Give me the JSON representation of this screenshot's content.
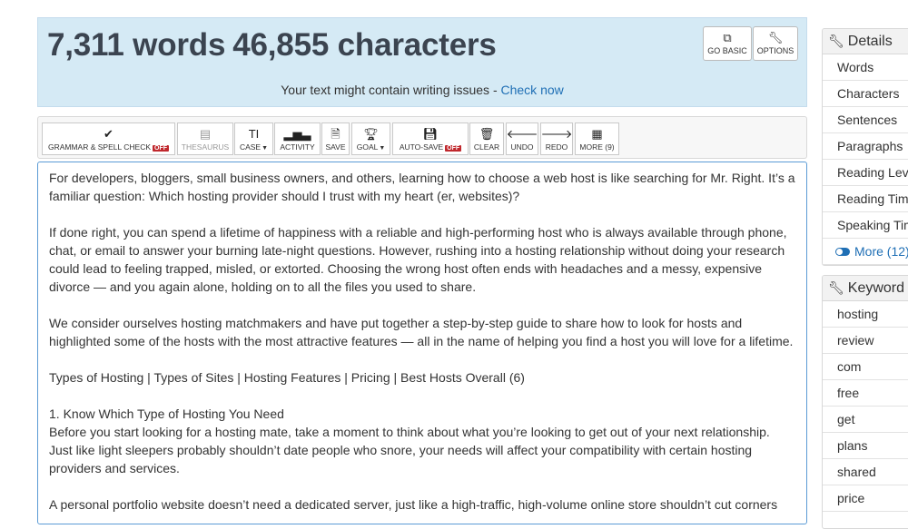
{
  "header": {
    "word_count": "7,311 words",
    "char_count": "46,855 characters",
    "go_basic_label": "GO BASIC",
    "options_label": "OPTIONS",
    "issues_text": "Your text might contain writing issues - ",
    "issues_link": "Check now"
  },
  "toolbar": {
    "grammar_label": "GRAMMAR & SPELL CHECK",
    "grammar_state": "OFF",
    "thesaurus_label": "THESAURUS",
    "case_label": "CASE",
    "activity_label": "ACTIVITY",
    "save_label": "SAVE",
    "goal_label": "GOAL",
    "autosave_label": "AUTO-SAVE",
    "autosave_state": "OFF",
    "clear_label": "CLEAR",
    "undo_label": "UNDO",
    "redo_label": "REDO",
    "more_label": "MORE (9)"
  },
  "editor": {
    "paragraphs": [
      "For developers, bloggers, small business owners, and others, learning how to choose a web host is like searching for Mr. Right. It’s a familiar question: Which hosting provider should I trust with my heart (er, websites)?",
      "If done right, you can spend a lifetime of happiness with a reliable and high-performing host who is always available through phone, chat, or email to answer your burning late-night questions. However, rushing into a hosting relationship without doing your research could lead to feeling trapped, misled, or extorted. Choosing the wrong host often ends with headaches and a messy, expensive divorce — and you again alone, holding on to all the files you used to share.",
      "We consider ourselves hosting matchmakers and have put together a step-by-step guide to share how to look for hosts and highlighted some of the hosts with the most attractive features — all in the name of helping you find a host you will love for a lifetime.",
      "Types of Hosting | Types of Sites | Hosting Features | Pricing | Best Hosts Overall (6)",
      "1. Know Which Type of Hosting You Need",
      "Before you start looking for a hosting mate, take a moment to think about what you’re looking to get out of your next relationship. Just like light sleepers probably shouldn’t date people who snore, your needs will affect your compatibility with certain hosting providers and services.",
      "A personal portfolio website doesn’t need a dedicated server, just like a high-traffic, high-volume online store shouldn’t cut corners"
    ]
  },
  "details": {
    "title": "Details",
    "rows": [
      "Words",
      "Characters",
      "Sentences",
      "Paragraphs",
      "Reading Level",
      "Reading Time",
      "Speaking Time"
    ],
    "more_label": "More (12)"
  },
  "keywords": {
    "title": "Keyword Density",
    "rows": [
      "hosting",
      "review",
      "com",
      "free",
      "get",
      "plans",
      "shared",
      "price"
    ]
  }
}
